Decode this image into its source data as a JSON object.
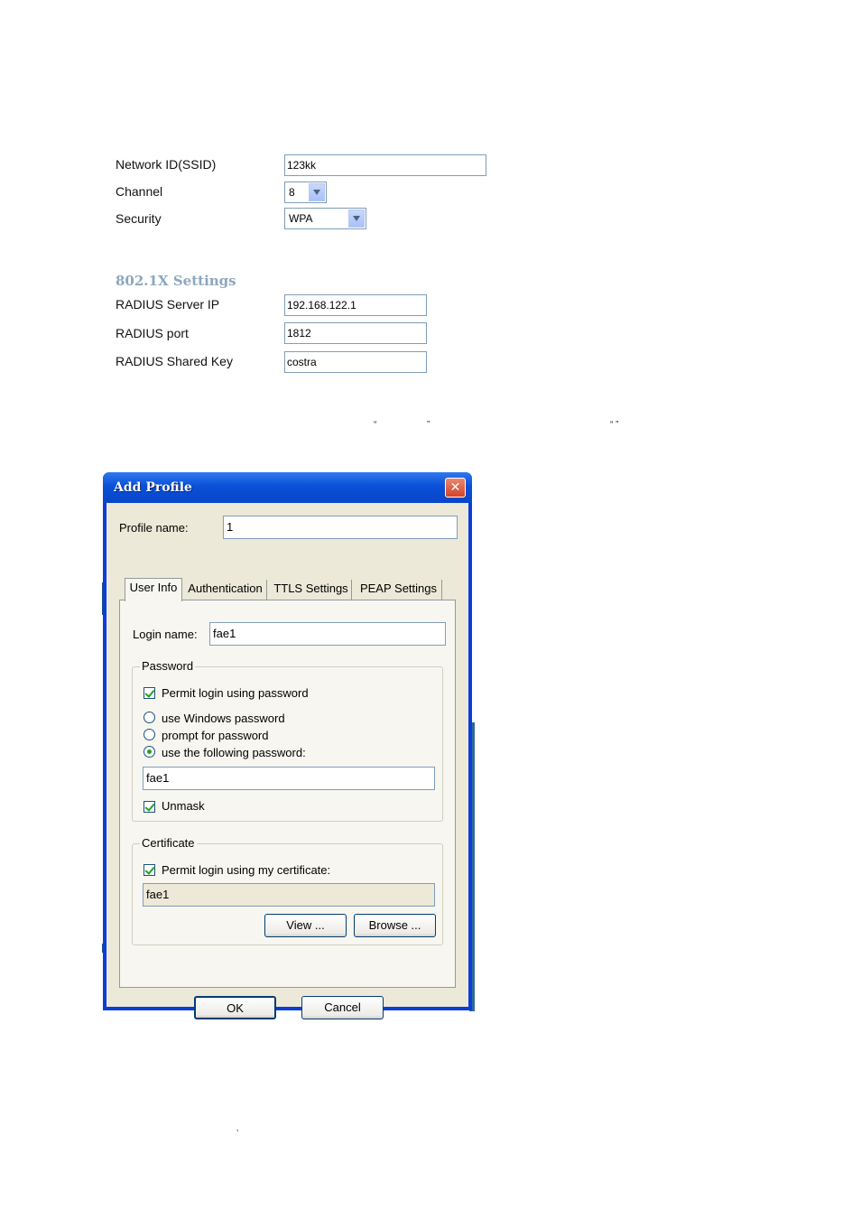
{
  "form": {
    "ssid_label": "Network ID(SSID)",
    "ssid_value": "123kk",
    "channel_label": "Channel",
    "channel_value": "8",
    "security_label": "Security",
    "security_value": "WPA",
    "section_title": "802.1X Settings",
    "radius_ip_label": "RADIUS Server IP",
    "radius_ip_value": "192.168.122.1",
    "radius_port_label": "RADIUS port",
    "radius_port_value": "1812",
    "radius_key_label": "RADIUS Shared Key",
    "radius_key_value": "costra"
  },
  "quotes": {
    "open1": "“",
    "close1": "”",
    "pair2": "“ ”",
    "apostrophe": "’"
  },
  "dialog": {
    "title": "Add Profile",
    "close_glyph": "✕",
    "profile_label": "Profile name:",
    "profile_value": "1",
    "tabs": [
      "User Info",
      "Authentication",
      "TTLS Settings",
      "PEAP Settings"
    ],
    "login_label": "Login name:",
    "login_value": "fae1",
    "password_group": "Password",
    "permit_password": "Permit login using password",
    "use_windows": "use Windows password",
    "prompt_password": "prompt for password",
    "use_following": "use the following password:",
    "password_value": "fae1",
    "unmask": "Unmask",
    "certificate_group": "Certificate",
    "permit_certificate": "Permit login using my certificate:",
    "certificate_value": "fae1",
    "view_button": "View ...",
    "browse_button": "Browse ...",
    "ok_button": "OK",
    "cancel_button": "Cancel"
  }
}
